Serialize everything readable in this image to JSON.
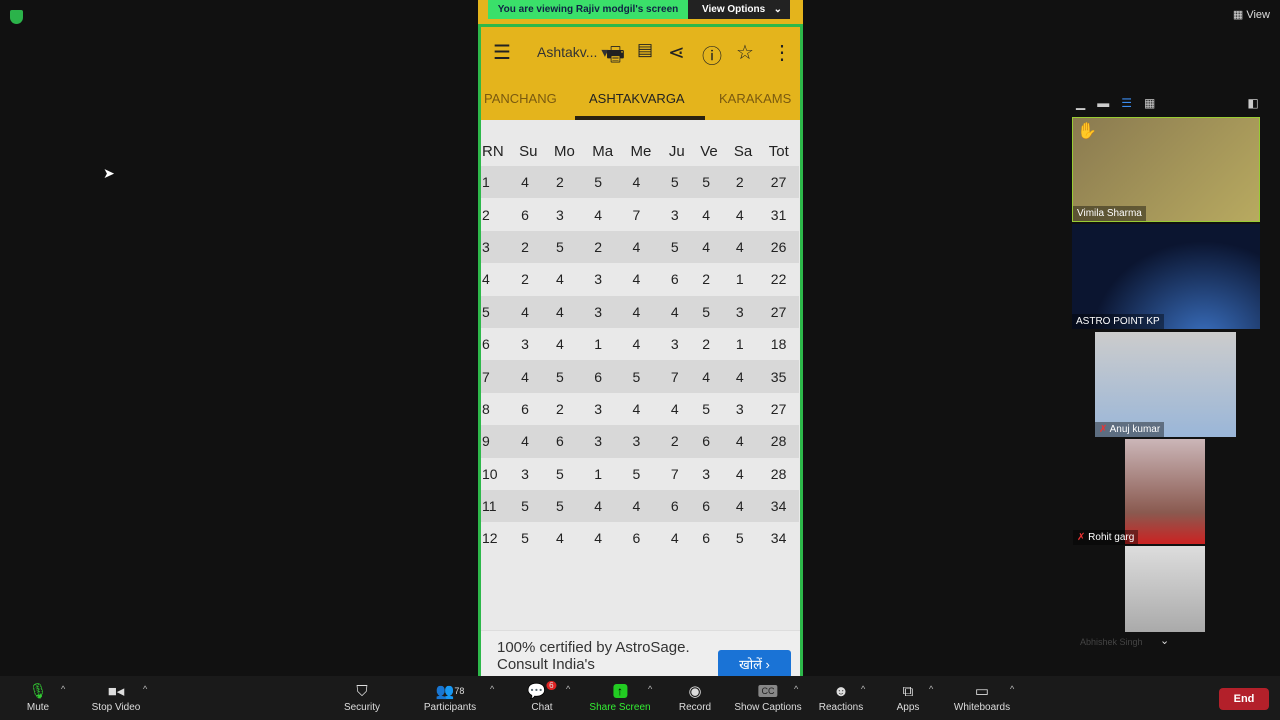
{
  "window": {
    "view_label": "View"
  },
  "share_banner": {
    "text": "You are viewing Rajiv modgil's screen",
    "options_label": "View Options"
  },
  "app": {
    "title": "Ashtakv...",
    "tabs": [
      "PANCHANG",
      "ASHTAKVARGA",
      "KARAKAMS"
    ],
    "active_tab": "ASHTAKVARGA",
    "accent": "#e4b41c"
  },
  "table": {
    "headers": [
      "RN",
      "Su",
      "Mo",
      "Ma",
      "Me",
      "Ju",
      "Ve",
      "Sa",
      "Tot"
    ],
    "rows": [
      [
        1,
        4,
        2,
        5,
        4,
        5,
        5,
        2,
        27
      ],
      [
        2,
        6,
        3,
        4,
        7,
        3,
        4,
        4,
        31
      ],
      [
        3,
        2,
        5,
        2,
        4,
        5,
        4,
        4,
        26
      ],
      [
        4,
        2,
        4,
        3,
        4,
        6,
        2,
        1,
        22
      ],
      [
        5,
        4,
        4,
        3,
        4,
        4,
        5,
        3,
        27
      ],
      [
        6,
        3,
        4,
        1,
        4,
        3,
        2,
        1,
        18
      ],
      [
        7,
        4,
        5,
        6,
        5,
        7,
        4,
        4,
        35
      ],
      [
        8,
        6,
        2,
        3,
        4,
        4,
        5,
        3,
        27
      ],
      [
        9,
        4,
        6,
        3,
        3,
        2,
        6,
        4,
        28
      ],
      [
        10,
        3,
        5,
        1,
        5,
        7,
        3,
        4,
        28
      ],
      [
        11,
        5,
        5,
        4,
        4,
        6,
        6,
        4,
        34
      ],
      [
        12,
        5,
        4,
        4,
        6,
        4,
        6,
        5,
        34
      ]
    ]
  },
  "ad": {
    "text": "100% certified by AstroSage. Consult India's",
    "button": "खोलें"
  },
  "participants": [
    {
      "name": "Vimila Sharma",
      "hand_raised": true
    },
    {
      "name": "ASTRO POINT KP"
    },
    {
      "name": "Anuj kumar",
      "muted": true
    },
    {
      "name": "Rohit garg",
      "muted": true
    },
    {
      "name": "Abhishek Singh",
      "muted": true
    }
  ],
  "toolbar": {
    "mute": "Mute",
    "stop_video": "Stop Video",
    "security": "Security",
    "participants": "Participants",
    "participant_count": "78",
    "chat": "Chat",
    "chat_badge": "6",
    "share": "Share Screen",
    "record": "Record",
    "captions": "Show Captions",
    "reactions": "Reactions",
    "apps": "Apps",
    "whiteboards": "Whiteboards",
    "end": "End"
  }
}
